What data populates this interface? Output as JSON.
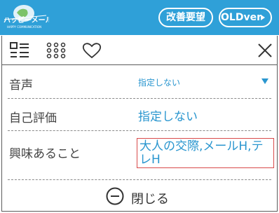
{
  "header": {
    "logo_text": "ハッピーメール",
    "logo_sub": "HAPPY COMMUNICATION",
    "improve_button": "改善要望",
    "old_version_button": "OLDver",
    "colors": {
      "bar": "#2fa0d8",
      "text": "#ffffff"
    }
  },
  "toolbar": {
    "icons": [
      "list-icon",
      "grid-icon",
      "heart-icon",
      "close-icon"
    ]
  },
  "rows": [
    {
      "label": "音声",
      "value": "指定しない"
    },
    {
      "label": "自己評価",
      "value": "指定しない"
    },
    {
      "label": "興味あること",
      "value": "大人の交際,メールH,テレH"
    }
  ],
  "footer": {
    "close_label": "閉じる"
  },
  "accent": "#2a96cf",
  "highlight": "#d84a4a"
}
